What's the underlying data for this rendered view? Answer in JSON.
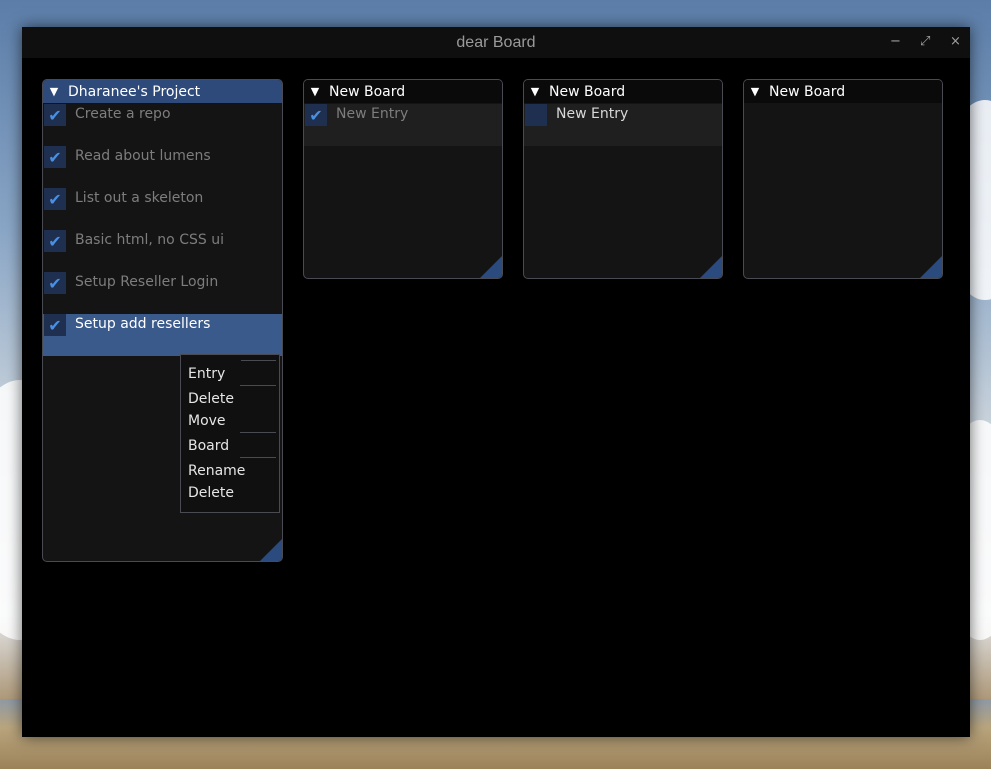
{
  "window": {
    "title": "dear Board",
    "controls": {
      "minimize": "−",
      "maximize": "⤢",
      "close": "×"
    }
  },
  "boards": [
    {
      "title": "Dharanee's Project",
      "entries": [
        {
          "label": "Create a repo",
          "checked": true
        },
        {
          "label": "Read about lumens",
          "checked": true
        },
        {
          "label": "List out a skeleton",
          "checked": true
        },
        {
          "label": "Basic html, no CSS ui",
          "checked": true
        },
        {
          "label": "Setup Reseller Login",
          "checked": true
        },
        {
          "label": "Setup add resellers",
          "checked": true
        }
      ]
    },
    {
      "title": "New Board",
      "entries": [
        {
          "label": "New Entry",
          "checked": true
        }
      ]
    },
    {
      "title": "New Board",
      "entries": [
        {
          "label": "New Entry",
          "checked": false
        }
      ]
    },
    {
      "title": "New Board",
      "entries": []
    }
  ],
  "context_menu": {
    "entry_header": "Entry",
    "entry_delete": "Delete",
    "entry_move": "Move",
    "board_header": "Board",
    "board_rename": "Rename",
    "board_delete": "Delete"
  },
  "icons": {
    "collapse_arrow": "▼",
    "check": "✔"
  },
  "colors": {
    "accent": "#2e4a7a",
    "selected_row": "#3a5a8c",
    "check": "#4a8fe0"
  }
}
